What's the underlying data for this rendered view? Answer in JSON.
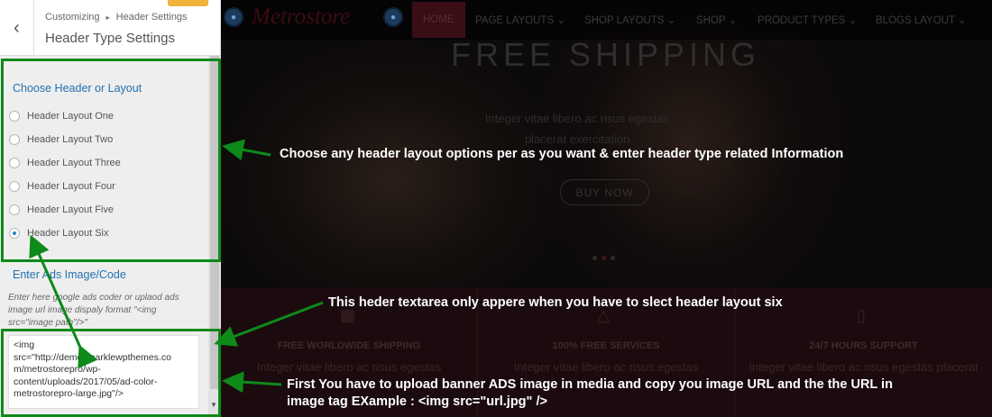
{
  "sidebar": {
    "back_icon": "chevron-left-icon",
    "breadcrumb_root": "Customizing",
    "breadcrumb_sep": "▸",
    "breadcrumb_current": "Header Settings",
    "title": "Header Type Settings",
    "header_section": {
      "title": "Choose Header or Layout",
      "options": [
        {
          "label": "Header Layout One",
          "checked": false
        },
        {
          "label": "Header Layout Two",
          "checked": false
        },
        {
          "label": "Header Layout Three",
          "checked": false
        },
        {
          "label": "Header Layout Four",
          "checked": false
        },
        {
          "label": "Header Layout Five",
          "checked": false
        },
        {
          "label": "Header Layout Six",
          "checked": true
        }
      ]
    },
    "ads_section": {
      "title": "Enter Ads Image/Code",
      "description": "Enter here google ads coder or uplaod ads image url image dispaly format \"<img src=\"image path\"/>\"",
      "value": "<img\nsrc=\"http://demo.sparklewpthemes.co\nm/metrostorepro/wp-\ncontent/uploads/2017/05/ad-color-\nmetrostorepro-large.jpg\"/>"
    }
  },
  "preview": {
    "logo": "Metrostore",
    "nav": [
      "HOME",
      "PAGE LAYOUTS ⌄",
      "SHOP LAYOUTS ⌄",
      "SHOP ⌄",
      "PRODUCT TYPES ⌄",
      "BLOGS LAYOUT ⌄"
    ],
    "hero": {
      "heading": "FREE SHIPPING",
      "sub_line1": "Integer vitae libero ac risus egestas",
      "sub_line2": "placerat exercitation",
      "button": "BUY NOW"
    },
    "features": [
      {
        "title": "FREE WORLDWIDE SHIPPING",
        "desc": "Integer vitae libero ac risus egestas",
        "icon": "truck-icon"
      },
      {
        "title": "100% FREE SERVICES",
        "desc": "Integer vitae libero ac risus egestas",
        "icon": "thumbs-up-icon"
      },
      {
        "title": "24/7 HOURS SUPPORT",
        "desc": "Integer vitae libero ac risus egestas placerat",
        "icon": "phone-icon"
      }
    ]
  },
  "annotations": {
    "layout_note": "Choose any header layout options per as you want & enter header type related Information",
    "textarea_note": "This heder textarea only appere when you have to slect header layout six",
    "upload_note_line1": "First You have to upload banner ADS image in media and copy you image URL and the the URL in",
    "upload_note_line2": "image tag  EXample : <img src=\"url.jpg\" />"
  },
  "colors": {
    "highlight": "#0d8a1a",
    "customizer_accent": "#2271b1",
    "save_button": "#f0b33a"
  }
}
